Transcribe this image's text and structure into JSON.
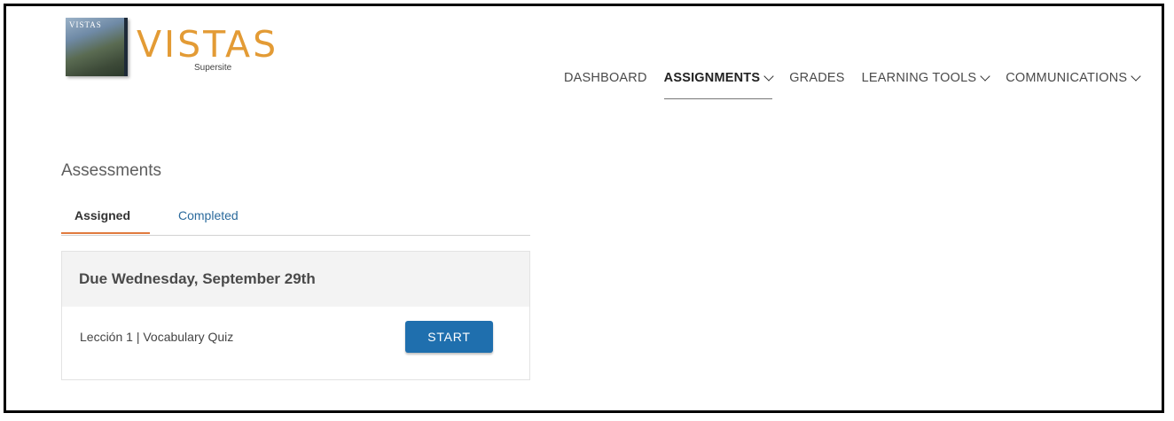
{
  "brand": {
    "book_label": "VISTAS",
    "name": "VISTAS",
    "sub": "Supersite"
  },
  "nav": [
    {
      "label": "DASHBOARD",
      "has_dropdown": false,
      "active": false
    },
    {
      "label": "ASSIGNMENTS",
      "has_dropdown": true,
      "active": true
    },
    {
      "label": "GRADES",
      "has_dropdown": false,
      "active": false
    },
    {
      "label": "LEARNING TOOLS",
      "has_dropdown": true,
      "active": false
    },
    {
      "label": "COMMUNICATIONS",
      "has_dropdown": true,
      "active": false
    }
  ],
  "assessments": {
    "title": "Assessments",
    "tabs": [
      {
        "label": "Assigned",
        "active": true
      },
      {
        "label": "Completed",
        "active": false
      }
    ],
    "card": {
      "due_label": "Due Wednesday, September 29th",
      "items": [
        {
          "label": "Lección 1 | Vocabulary Quiz",
          "action": "START"
        }
      ]
    }
  },
  "colors": {
    "brand_orange": "#e39b35",
    "accent_tab": "#e07a3e",
    "link_blue": "#2b6a9c",
    "button_blue": "#1f6fae"
  }
}
